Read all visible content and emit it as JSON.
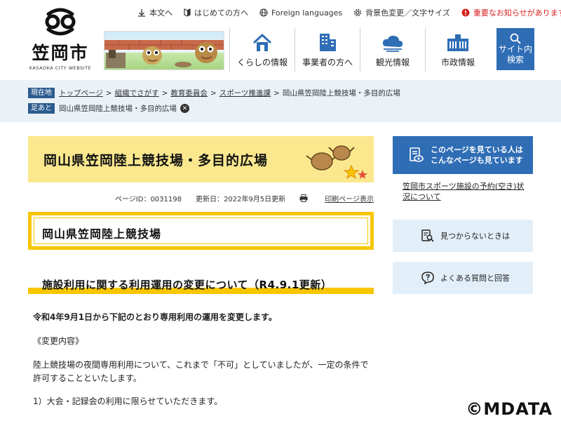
{
  "site": {
    "logo_text": "笠岡市",
    "logo_sub": "KASAOKA CITY WEBSITE"
  },
  "utility": [
    {
      "label": "本文へ",
      "icon": "arrow-down-icon"
    },
    {
      "label": "はじめての方へ",
      "icon": "beginner-icon"
    },
    {
      "label": "Foreign languages",
      "icon": "globe-icon"
    },
    {
      "label": "背景色変更／文字サイズ",
      "icon": "gear-icon"
    },
    {
      "label": "重要なお知らせがあります",
      "icon": "alert-icon"
    }
  ],
  "nav": [
    {
      "label": "くらしの情報",
      "icon": "house-icon"
    },
    {
      "label": "事業者の方へ",
      "icon": "building-icon"
    },
    {
      "label": "観光情報",
      "icon": "cloud-icon"
    },
    {
      "label": "市政情報",
      "icon": "city-hall-icon"
    }
  ],
  "search": {
    "line1": "サイト内",
    "line2": "検索"
  },
  "breadcrumb": {
    "current_tag": "現在地",
    "items": [
      "トップページ",
      "組織でさがす",
      "教育委員会",
      "スポーツ推進課"
    ],
    "current": "岡山県笠岡陸上競技場・多目的広場",
    "history_tag": "足あと",
    "history_item": "岡山県笠岡陸上競技場・多目的広場"
  },
  "page": {
    "title": "岡山県笠岡陸上競技場・多目的広場",
    "page_id": "ページID：0031198",
    "updated": "更新日：2022年9月5日更新",
    "print": "印刷ページ表示",
    "h2": "岡山県笠岡陸上競技場",
    "h3": "施設利用に関する利用運用の変更について（R4.9.1更新）",
    "p1": "令和4年9月1日から下記のとおり専用利用の運用を変更します。",
    "p2": "《変更内容》",
    "p3": "陸上競技場の夜間専用利用について、これまで「不可」としていましたが、一定の条件で許可することといたします。",
    "p4": "1）大会・記録会の利用に限らせていただきます。"
  },
  "sidebar": {
    "related": "このページを見ている人は こんなページも見ています",
    "related_line1": "このページを見ている人は",
    "related_line2": "こんなページも見ています",
    "link": "笠岡市スポーツ施設の予約(空き)状況について",
    "not_found": "見つからないときは",
    "faq": "よくある質問と回答"
  },
  "watermark": "©MDATA",
  "colors": {
    "brand_blue": "#2f6db5",
    "accent_yellow": "#f7c600",
    "title_bg": "#fbe88e",
    "crumb_bg": "#eaf2f8",
    "alert_red": "#d81f1f"
  }
}
